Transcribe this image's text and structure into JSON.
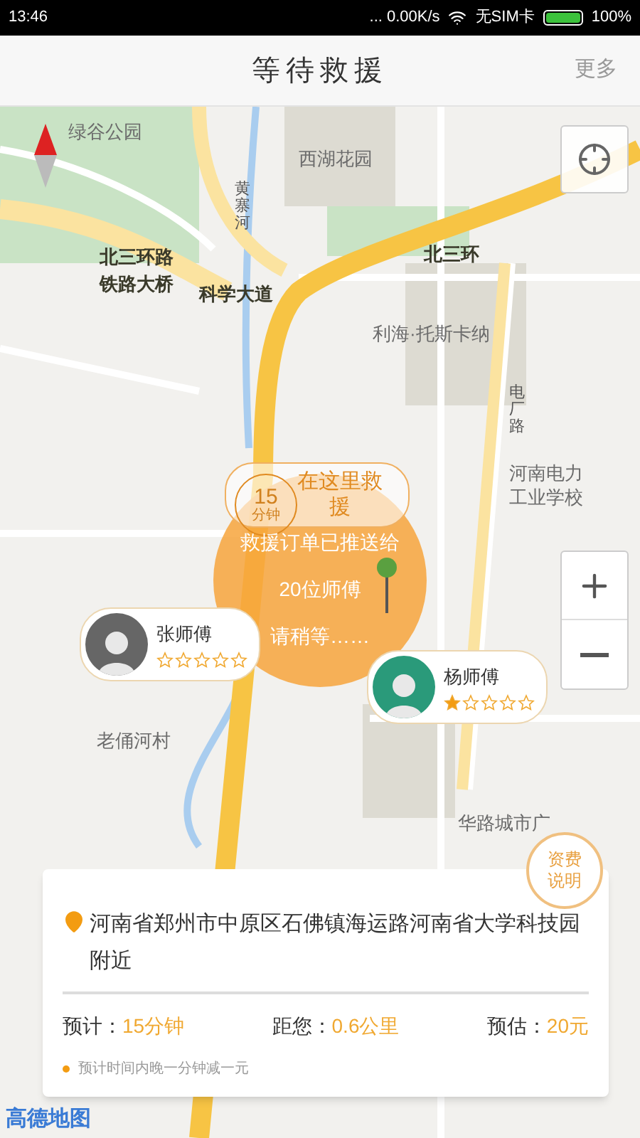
{
  "status_bar": {
    "time": "13:46",
    "network_speed": "... 0.00K/s",
    "sim": "无SIM卡",
    "battery": "100%"
  },
  "header": {
    "title": "等待救援",
    "more": "更多"
  },
  "map": {
    "labels": [
      {
        "text": "绿谷公园",
        "kind": "area"
      },
      {
        "text": "西湖花园",
        "kind": "area"
      },
      {
        "text": "黄寨河",
        "kind": "vertical"
      },
      {
        "text": "北三环路",
        "kind": "road"
      },
      {
        "text": "铁路大桥",
        "kind": "road"
      },
      {
        "text": "科学大道",
        "kind": "road"
      },
      {
        "text": "北三环",
        "kind": "road"
      },
      {
        "text": "利海·托斯卡纳",
        "kind": "area"
      },
      {
        "text": "电厂路",
        "kind": "vertical"
      },
      {
        "text": "河南电力",
        "kind": "area"
      },
      {
        "text": "工业学校",
        "kind": "area"
      },
      {
        "text": "老俑河村",
        "kind": "area"
      },
      {
        "text": "华路城市广",
        "kind": "area"
      }
    ],
    "eta_badge": {
      "value": "15",
      "unit": "分钟"
    },
    "pin_callout": "在这里救援",
    "dispatch_message": [
      "救援订单已推送给",
      "20位师傅",
      "请稍等……"
    ],
    "drivers": [
      {
        "name": "张师傅",
        "stars": 0
      },
      {
        "name": "杨师傅",
        "stars": 1
      }
    ],
    "logo": "高德地图"
  },
  "order_card": {
    "fee_button": "资费说明",
    "address": "河南省郑州市中原区石佛镇海运路河南省大学科技园附近",
    "stats": [
      {
        "label": "预计：",
        "value": "15分钟"
      },
      {
        "label": "距您：",
        "value": "0.6公里"
      },
      {
        "label": "预估：",
        "value": "20元"
      }
    ],
    "note": "预计时间内晚一分钟减一元"
  }
}
